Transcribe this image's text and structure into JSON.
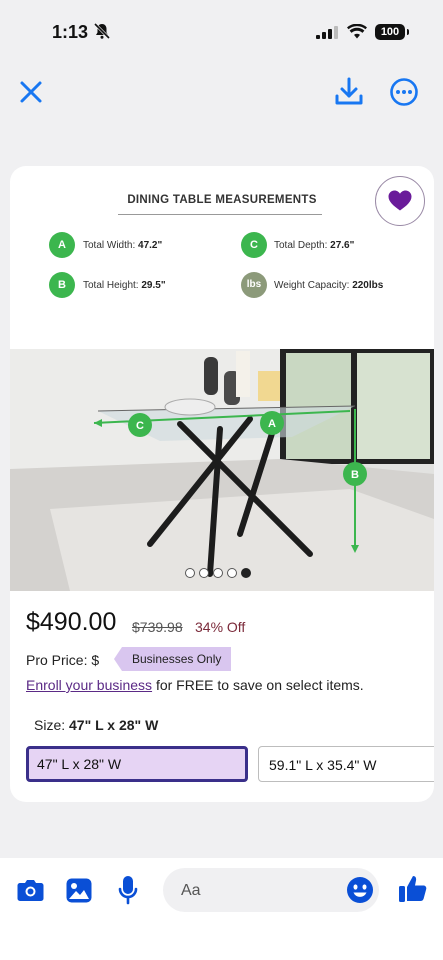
{
  "status": {
    "time": "1:13",
    "battery": "100"
  },
  "card": {
    "measurements_title": "DINING TABLE MEASUREMENTS",
    "measurements": [
      {
        "badge": "A",
        "label": "Total Width:",
        "value": "47.2\""
      },
      {
        "badge": "C",
        "label": "Total Depth:",
        "value": "27.6\""
      },
      {
        "badge": "B",
        "label": "Total Height:",
        "value": "29.5\""
      },
      {
        "badge": "lbs",
        "label": "Weight Capacity:",
        "value": "220lbs"
      }
    ],
    "photo_labels": {
      "a": "A",
      "b": "B",
      "c": "C"
    },
    "carousel": {
      "count": 5,
      "active_index": 4
    }
  },
  "product": {
    "price": "$490.00",
    "original_price": "$739.98",
    "discount": "34% Off",
    "pro_price_label": "Pro Price: $",
    "business_only": "Businesses Only",
    "enroll_link": "Enroll your business",
    "enroll_rest": " for FREE to save on select items.",
    "size_label": "Size:",
    "size_value": "47\" L x 28\" W",
    "options": [
      "47\" L x 28\" W",
      "59.1\" L x 35.4\" W"
    ]
  },
  "composer": {
    "placeholder": "Aa"
  },
  "colors": {
    "accent": "#1877f2",
    "messenger_blue": "#0a4fd6",
    "green_badge": "#3cb64e",
    "heart": "#6a1b9a"
  }
}
